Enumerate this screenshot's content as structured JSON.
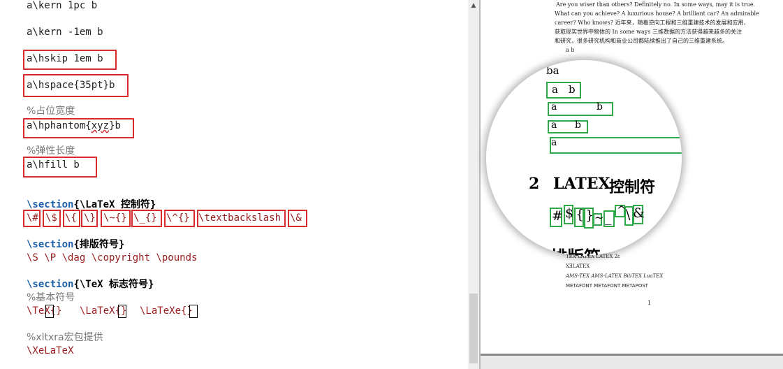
{
  "editor": {
    "lines": {
      "kern_pc": "a\\kern 1pc b",
      "kern_neg": "a\\kern -1em b",
      "hskip": "a\\hskip 1em b",
      "hspace": "a\\hspace{35pt}b",
      "comment_phantom": "%占位宽度",
      "hphantom_a": "a\\hphantom{",
      "hphantom_arg": "xyz",
      "hphantom_b": "}b",
      "comment_elastic": "%弹性长度",
      "hfill": "a\\hfill b",
      "section1_kw": "\\section",
      "section1_arg": "{\\LaTeX 控制符}",
      "special_chars": [
        "\\#",
        "\\$",
        "\\{",
        "\\}",
        "\\~{}",
        "\\_{}",
        "\\^{}",
        "\\textbackslash",
        "\\&"
      ],
      "section2_kw": "\\section",
      "section2_arg": "{排版符号}",
      "symbols": "\\S \\P \\dag \\copyright \\pounds",
      "section3_kw": "\\section",
      "section3_arg": "{\\TeX 标志符号}",
      "comment_basic": "%基本符号",
      "tex_logos": [
        "\\TeX{}",
        "\\LaTeX{}",
        "\\LaTeXe{}"
      ],
      "comment_xltxtra": "%xltxra宏包提供",
      "xelatex": "\\XeLaTeX"
    }
  },
  "preview": {
    "para": [
      "Are you wiser than others? Definitely no. In some ways, may it is true.",
      "What can you achieve? A luxurious house? A brilliant car? An admirable",
      "career? Who knows? 近年来，随着逆向工程和三维重建技术的发展和应用，",
      "获取现实世界中物体的 In some ways 三维数据的方法获得越来越多的关注",
      "和研究，很多研究机构和商业公司都陆续推出了自己的三维重建系统。"
    ],
    "ab_small": "a  b",
    "logos_line1": "TEX  LATEX  LATEX 2ε",
    "logos_line2": "XƎLATEX",
    "logos_line3": "AMS-TEX  AMS-LATEX  BibTEX  LuaTEX",
    "logos_line4": "METAFONT  METAFONT  METAPOST",
    "page_number": "1",
    "magnifier": {
      "ba": "ba",
      "ab_rows": [
        {
          "a": "a",
          "b": "b"
        },
        {
          "a": "a",
          "b": "b"
        },
        {
          "a": "a",
          "b": "b"
        },
        {
          "a": "a",
          "b": "b"
        }
      ],
      "section_num": "2",
      "section_title_logo": "LATEX",
      "section_title_text": "控制符",
      "chars": [
        "#",
        "$",
        "{",
        "}",
        "~",
        "_",
        "^",
        "\\",
        "&"
      ],
      "next_section": "排版符"
    }
  },
  "colors": {
    "editor_box": "#d62c2c",
    "preview_box": "#2fa84a",
    "section_keyword": "#1d5fa8",
    "comment": "#7a7a7a"
  }
}
